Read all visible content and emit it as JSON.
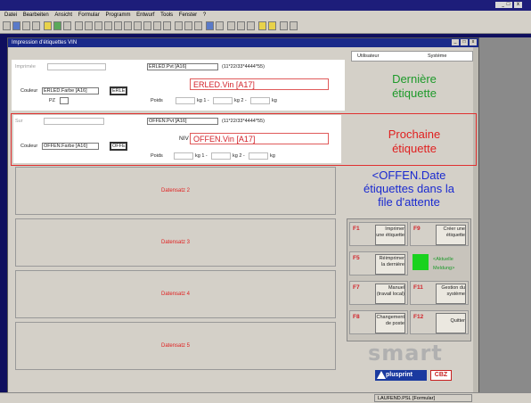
{
  "app": {
    "menu": [
      "Datei",
      "Bearbeiten",
      "Ansicht",
      "Formular",
      "Programm",
      "Entwurf",
      "Tools",
      "Fenster",
      "?"
    ],
    "title_controls": [
      "_",
      "□",
      "x"
    ]
  },
  "window": {
    "title": "Impression d'étiquettes VIN",
    "controls": [
      "_",
      "□",
      "x"
    ]
  },
  "top_tabs": [
    "Utilisateur",
    "Système"
  ],
  "last_label": {
    "imprimee_label": "Imprimée",
    "field1": "ERLED.Pvt [A16]",
    "code1": "(11*22/33*4444*55)",
    "vin": "ERLED.Vin [A17]",
    "couleur_label": "Couleur",
    "couleur_value": "ERLED.Farbe [A16]",
    "small_btn": "ERLE",
    "pz_label": "PZ",
    "poids_label": "Poids",
    "kg": "kg",
    "kg1": "kg 1 -",
    "kg2": "kg 2 -",
    "caption_line1": "Dernière",
    "caption_line2": "étiquette"
  },
  "next_label": {
    "sur_label": "Sur",
    "field1": "OFFEN.Pvt [A16]",
    "code1": "(11*22/33*4444*55)",
    "niv_label": "NIV",
    "vin": "OFFEN.Vin [A17]",
    "couleur_label": "Couleur",
    "couleur_value": "OFFEN.Farbe [A16]",
    "small_btn": "OFFE",
    "poids_label": "Poids",
    "kg": "kg",
    "kg1": "kg 1 -",
    "kg2": "kg 2 -",
    "caption_line1": "Prochaine",
    "caption_line2": "étiquette"
  },
  "queue": {
    "line1": "<OFFEN.Date",
    "line2": "étiquettes dans la",
    "line3": "file d'attente"
  },
  "datasets": [
    "Datensatz 2",
    "Datensatz 3",
    "Datensatz 4",
    "Datensatz 5"
  ],
  "fkeys": [
    {
      "key": "F1",
      "label1": "Imprimer",
      "label2": "une étiquette"
    },
    {
      "key": "F9",
      "label1": "Créer une",
      "label2": "étiquette"
    },
    {
      "key": "F5",
      "label1": "Réimprimer",
      "label2": "la dernière"
    },
    {
      "key": "F7",
      "label1": "Manuel",
      "label2": "(travail local)"
    },
    {
      "key": "F11",
      "label1": "Gestion du",
      "label2": "système"
    },
    {
      "key": "F8",
      "label1": "Changement",
      "label2": "de poste"
    },
    {
      "key": "F12",
      "label1": "Quitter",
      "label2": ""
    }
  ],
  "status_indicator": {
    "line1": "<Aktuelle",
    "line2": "Meldung>",
    "color": "#19d21e"
  },
  "brand": {
    "smart": "smart",
    "plusprint": "plusprint",
    "cbz": "CBZ"
  },
  "statusbar": {
    "text": "LAUFEND.PSL [Formular]"
  },
  "colors": {
    "accent_red": "#d2222a",
    "accent_green": "#1d9a2a",
    "accent_blue": "#1a2ad0",
    "title_blue": "#1a2a8a"
  }
}
